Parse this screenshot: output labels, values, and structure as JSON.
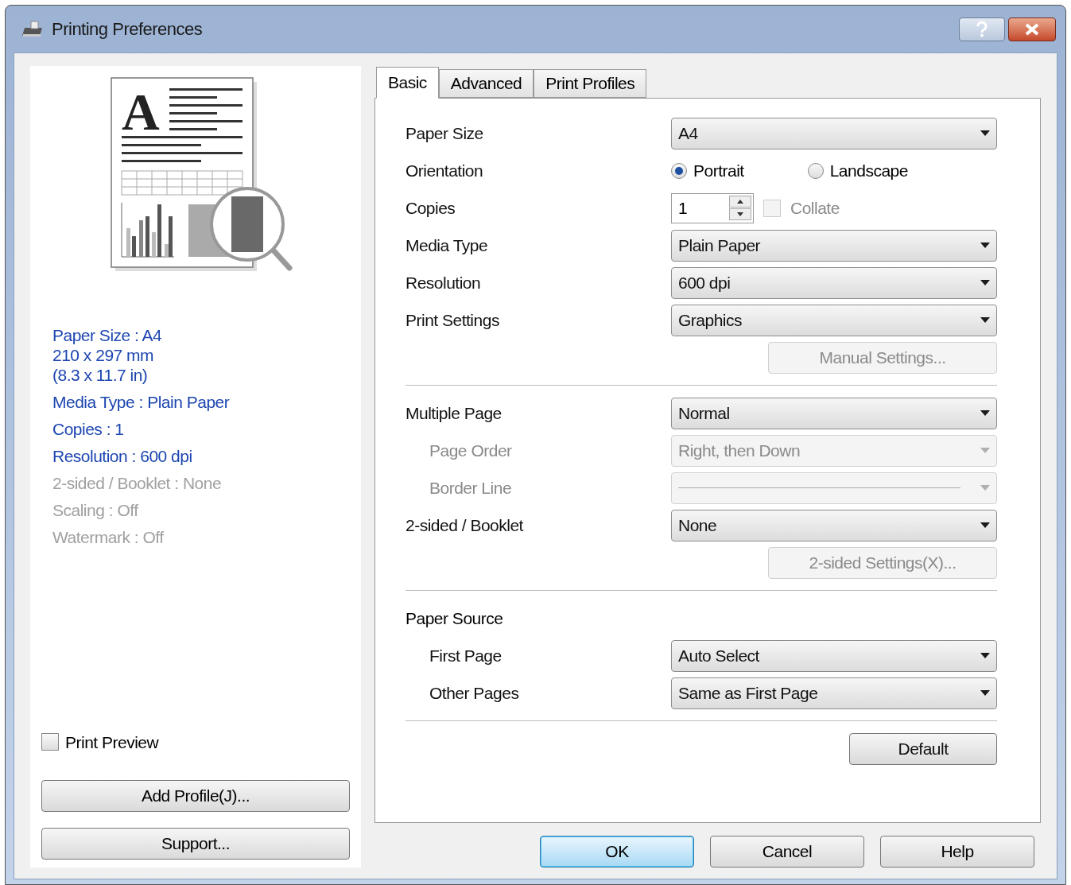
{
  "window": {
    "title": "Printing Preferences"
  },
  "preview": {
    "letter": "A"
  },
  "summary": [
    {
      "lines": [
        "Paper Size : A4",
        "210 x 297 mm",
        "(8.3 x 11.7 in)"
      ],
      "disabled": false
    },
    {
      "lines": [
        "Media Type : Plain Paper"
      ],
      "disabled": false
    },
    {
      "lines": [
        "Copies : 1"
      ],
      "disabled": false
    },
    {
      "lines": [
        "Resolution : 600 dpi"
      ],
      "disabled": false
    },
    {
      "lines": [
        "2-sided / Booklet : None"
      ],
      "disabled": true
    },
    {
      "lines": [
        "Scaling : Off"
      ],
      "disabled": true
    },
    {
      "lines": [
        "Watermark : Off"
      ],
      "disabled": true
    }
  ],
  "print_preview": {
    "label": "Print Preview",
    "checked": false
  },
  "left_buttons": [
    "Add Profile(J)...",
    "Support..."
  ],
  "tabs": [
    {
      "label": "Basic",
      "selected": true
    },
    {
      "label": "Advanced",
      "selected": false
    },
    {
      "label": "Print Profiles",
      "selected": false
    }
  ],
  "settings": [
    {
      "kind": "select",
      "label": "Paper Size",
      "value": "A4",
      "disabled": false,
      "indent": false
    },
    {
      "kind": "radio",
      "label": "Orientation",
      "options": [
        {
          "label": "Portrait",
          "selected": true
        },
        {
          "label": "Landscape",
          "selected": false
        }
      ]
    },
    {
      "kind": "spinner",
      "label": "Copies",
      "value": "1",
      "checkbox": {
        "label": "Collate",
        "checked": false,
        "disabled": true
      }
    },
    {
      "kind": "select",
      "label": "Media Type",
      "value": "Plain Paper",
      "disabled": false,
      "indent": false
    },
    {
      "kind": "select",
      "label": "Resolution",
      "value": "600 dpi",
      "disabled": false,
      "indent": false
    },
    {
      "kind": "select",
      "label": "Print Settings",
      "value": "Graphics",
      "disabled": false,
      "indent": false
    },
    {
      "kind": "button",
      "label": "Manual Settings...",
      "disabled": true
    },
    {
      "kind": "divider"
    },
    {
      "kind": "select",
      "label": "Multiple Page",
      "value": "Normal",
      "disabled": false,
      "indent": false
    },
    {
      "kind": "select",
      "label": "Page Order",
      "value": "Right, then Down",
      "disabled": true,
      "indent": true
    },
    {
      "kind": "line-select",
      "label": "Border Line",
      "disabled": true,
      "indent": true
    },
    {
      "kind": "select",
      "label": "2-sided / Booklet",
      "value": "None",
      "disabled": false,
      "indent": false
    },
    {
      "kind": "button",
      "label": "2-sided Settings(X)...",
      "disabled": true
    },
    {
      "kind": "divider"
    },
    {
      "kind": "heading",
      "label": "Paper Source"
    },
    {
      "kind": "select",
      "label": "First Page",
      "value": "Auto Select",
      "disabled": false,
      "indent": true
    },
    {
      "kind": "select",
      "label": "Other Pages",
      "value": "Same as First Page",
      "disabled": false,
      "indent": true
    },
    {
      "kind": "divider"
    },
    {
      "kind": "button",
      "label": "Default",
      "disabled": false
    }
  ],
  "dialog_buttons": [
    {
      "label": "OK",
      "default": true
    },
    {
      "label": "Cancel",
      "default": false
    },
    {
      "label": "Help",
      "default": false
    }
  ]
}
